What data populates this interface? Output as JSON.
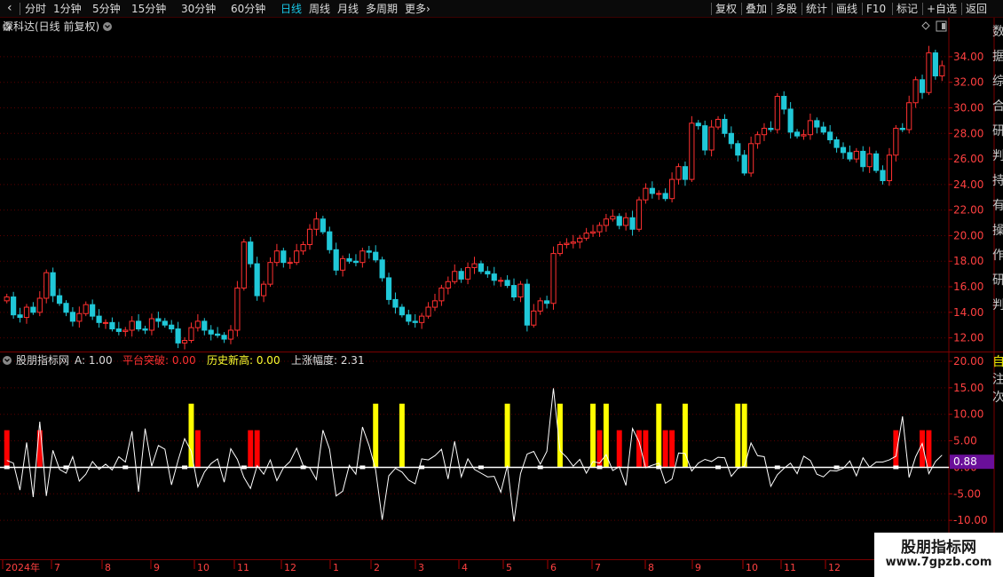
{
  "toolbar": {
    "period_tabs": [
      {
        "label": "分时",
        "active": false
      },
      {
        "label": "1分钟",
        "active": false
      },
      {
        "label": "5分钟",
        "active": false
      },
      {
        "label": "15分钟",
        "active": false
      },
      {
        "label": "30分钟",
        "active": false
      },
      {
        "label": "60分钟",
        "active": false
      },
      {
        "label": "日线",
        "active": true
      },
      {
        "label": "周线",
        "active": false
      },
      {
        "label": "月线",
        "active": false
      },
      {
        "label": "多周期",
        "active": false
      },
      {
        "label": "更多",
        "active": false
      }
    ],
    "more_arrow": "›",
    "right_buttons": [
      "复权",
      "叠加",
      "多股",
      "统计",
      "画线",
      "F10",
      "标记",
      "+自选",
      "返回"
    ]
  },
  "main_panel": {
    "title": "深科达(日线 前复权)",
    "title_icon": "chevron-down-circle-icon",
    "corner_icons": [
      "diamond-icon",
      "panel-toggle-icon"
    ],
    "price_axis": [
      "34.00",
      "32.00",
      "30.00",
      "28.00",
      "26.00",
      "24.00",
      "22.00",
      "20.00",
      "18.00",
      "16.00",
      "14.00",
      "12.00"
    ],
    "side_text": "数据综合研判持有操作研判"
  },
  "indicator_panel": {
    "name": "股朋指标网",
    "fields": [
      {
        "label": "A:",
        "value": "1.00",
        "color": "#dddddd"
      },
      {
        "label": "平台突破:",
        "value": "0.00",
        "color": "#ff3030"
      },
      {
        "label": "历史新高:",
        "value": "0.00",
        "color": "#ffff30"
      },
      {
        "label": "上涨幅度:",
        "value": "2.31",
        "color": "#dddddd"
      }
    ],
    "axis": [
      "20.00",
      "15.00",
      "10.00",
      "5.00",
      "0.00",
      "-5.00",
      "-10.00"
    ],
    "current_value": "0.88",
    "current_color": "#6a0f9a",
    "side_text": "自注次"
  },
  "date_axis": [
    "2024年",
    "7",
    "8",
    "9",
    "10",
    "11",
    "12",
    "1",
    "2",
    "3",
    "4",
    "5",
    "6",
    "7",
    "8",
    "9",
    "10",
    "11",
    "12"
  ],
  "watermark": {
    "title": "股朋指标网",
    "url": "www.7gpzb.com"
  },
  "colors": {
    "up": "#ff3030",
    "down": "#20c8d8",
    "signal_red": "#ff0000",
    "signal_yellow": "#ffff00",
    "line": "#ffffff"
  },
  "chart_data": {
    "type": "candlestick",
    "title": "深科达(日线 前复权)",
    "ylim": [
      11.0,
      35.8
    ],
    "closes": [
      15.2,
      13.8,
      13.6,
      14.4,
      14.0,
      15.1,
      17.1,
      15.3,
      14.7,
      14.0,
      13.3,
      13.9,
      14.6,
      13.7,
      13.2,
      13.2,
      12.7,
      12.5,
      12.6,
      13.3,
      12.7,
      12.6,
      13.5,
      13.3,
      13.0,
      12.7,
      11.6,
      11.8,
      12.8,
      13.3,
      12.6,
      12.3,
      12.2,
      11.9,
      12.6,
      15.9,
      19.5,
      17.8,
      15.3,
      16.2,
      17.9,
      18.8,
      17.9,
      17.9,
      18.8,
      19.3,
      20.5,
      21.3,
      20.3,
      18.9,
      17.3,
      18.2,
      18.0,
      17.9,
      18.8,
      18.7,
      18.1,
      16.7,
      15.0,
      14.4,
      13.8,
      13.3,
      13.2,
      13.7,
      14.4,
      14.9,
      15.9,
      16.4,
      17.2,
      16.6,
      17.5,
      17.8,
      17.2,
      17.0,
      16.5,
      16.5,
      16.1,
      15.2,
      16.2,
      13.0,
      14.1,
      14.9,
      14.7,
      18.6,
      19.3,
      19.4,
      19.5,
      19.8,
      20.2,
      20.3,
      20.8,
      21.3,
      21.5,
      20.8,
      21.4,
      20.5,
      22.8,
      23.7,
      23.3,
      23.3,
      22.9,
      24.4,
      25.4,
      24.4,
      28.8,
      28.6,
      26.7,
      28.5,
      29.1,
      28.0,
      27.2,
      26.3,
      24.9,
      27.2,
      27.9,
      28.4,
      28.3,
      30.9,
      29.9,
      28.1,
      27.8,
      27.9,
      29.0,
      28.5,
      28.1,
      27.5,
      26.9,
      26.5,
      26.0,
      26.6,
      25.4,
      26.4,
      25.1,
      24.3,
      26.3,
      28.4,
      28.3,
      30.4,
      32.2,
      31.2,
      34.3,
      32.5,
      33.3
    ],
    "indicator": {
      "name": "股朋指标网",
      "ylim": [
        -17.0,
        21.5
      ],
      "A": 1.0,
      "platform_breakout": 0.0,
      "historical_high": 0.0,
      "rise_pct": 2.31,
      "series_line": [
        1.3,
        0.8,
        -4.3,
        4.7,
        -5.6,
        8.6,
        -5.4,
        3.2,
        -0.4,
        -1.1,
        2.0,
        -2.6,
        -1.3,
        1.1,
        -0.4,
        0.6,
        -0.5,
        2.0,
        1.0,
        6.8,
        -4.6,
        7.3,
        0.2,
        4.1,
        3.4,
        -3.3,
        1.3,
        5.4,
        3.0,
        -3.7,
        -0.9,
        0.7,
        1.6,
        -2.8,
        3.5,
        1.5,
        -1.9,
        -4.0,
        0.3,
        -1.3,
        1.4,
        -2.5,
        -0.1,
        1.1,
        3.6,
        0.3,
        -0.1,
        -2.3,
        7.0,
        3.4,
        -5.4,
        -4.5,
        0.4,
        -1.3,
        7.6,
        4.1,
        -0.5,
        -9.9,
        -1.6,
        -0.2,
        -0.9,
        -2.4,
        -3.1,
        1.6,
        1.4,
        2.2,
        3.4,
        -2.2,
        4.9,
        -1.8,
        1.6,
        -0.4,
        -1.1,
        -1.8,
        -1.7,
        -4.7,
        0.3,
        -10.2,
        -1.2,
        2.5,
        3.0,
        0.6,
        3.0,
        14.9,
        3.1,
        1.9,
        0.2,
        1.5,
        -1.1,
        1.1,
        0.8,
        2.4,
        -0.6,
        0.1,
        -3.4,
        7.3,
        4.8,
        -0.1,
        0.4,
        0.8,
        -3.0,
        -2.2,
        2.7,
        2.6,
        -0.7,
        0.8,
        1.5,
        1.1,
        1.9,
        1.8,
        -1.7,
        -0.2,
        0.2,
        4.6,
        2.2,
        2.0,
        -3.6,
        -1.4,
        -0.2,
        0.8,
        -1.2,
        2.1,
        1.3,
        -1.3,
        -1.8,
        -0.6,
        -0.7,
        -0.2,
        1.2,
        -1.6,
        1.8,
        0.0,
        1.0,
        1.0,
        1.4,
        2.1,
        9.6,
        -1.9,
        2.0,
        4.5,
        -1.2,
        1.1,
        2.3
      ],
      "signal_bars": [
        {
          "index": 0,
          "color": "red",
          "value": 7.0
        },
        {
          "index": 5,
          "color": "red",
          "value": 7.0
        },
        {
          "index": 28,
          "color": "yellow",
          "value": 12.0
        },
        {
          "index": 29,
          "color": "red",
          "value": 7.0
        },
        {
          "index": 37,
          "color": "red",
          "value": 7.0
        },
        {
          "index": 38,
          "color": "red",
          "value": 7.0
        },
        {
          "index": 56,
          "color": "yellow",
          "value": 12.0
        },
        {
          "index": 60,
          "color": "yellow",
          "value": 12.0
        },
        {
          "index": 76,
          "color": "yellow",
          "value": 12.0
        },
        {
          "index": 84,
          "color": "yellow",
          "value": 12.0
        },
        {
          "index": 89,
          "color": "yellow",
          "value": 12.0
        },
        {
          "index": 90,
          "color": "red",
          "value": 7.0
        },
        {
          "index": 91,
          "color": "yellow",
          "value": 12.0
        },
        {
          "index": 93,
          "color": "red",
          "value": 7.0
        },
        {
          "index": 96,
          "color": "red",
          "value": 7.0
        },
        {
          "index": 97,
          "color": "red",
          "value": 7.0
        },
        {
          "index": 99,
          "color": "yellow",
          "value": 12.0
        },
        {
          "index": 100,
          "color": "red",
          "value": 7.0
        },
        {
          "index": 101,
          "color": "red",
          "value": 7.0
        },
        {
          "index": 103,
          "color": "yellow",
          "value": 12.0
        },
        {
          "index": 111,
          "color": "yellow",
          "value": 12.0
        },
        {
          "index": 112,
          "color": "yellow",
          "value": 12.0
        },
        {
          "index": 135,
          "color": "red",
          "value": 7.0
        },
        {
          "index": 139,
          "color": "red",
          "value": 7.0
        },
        {
          "index": 140,
          "color": "red",
          "value": 7.0
        }
      ]
    }
  }
}
